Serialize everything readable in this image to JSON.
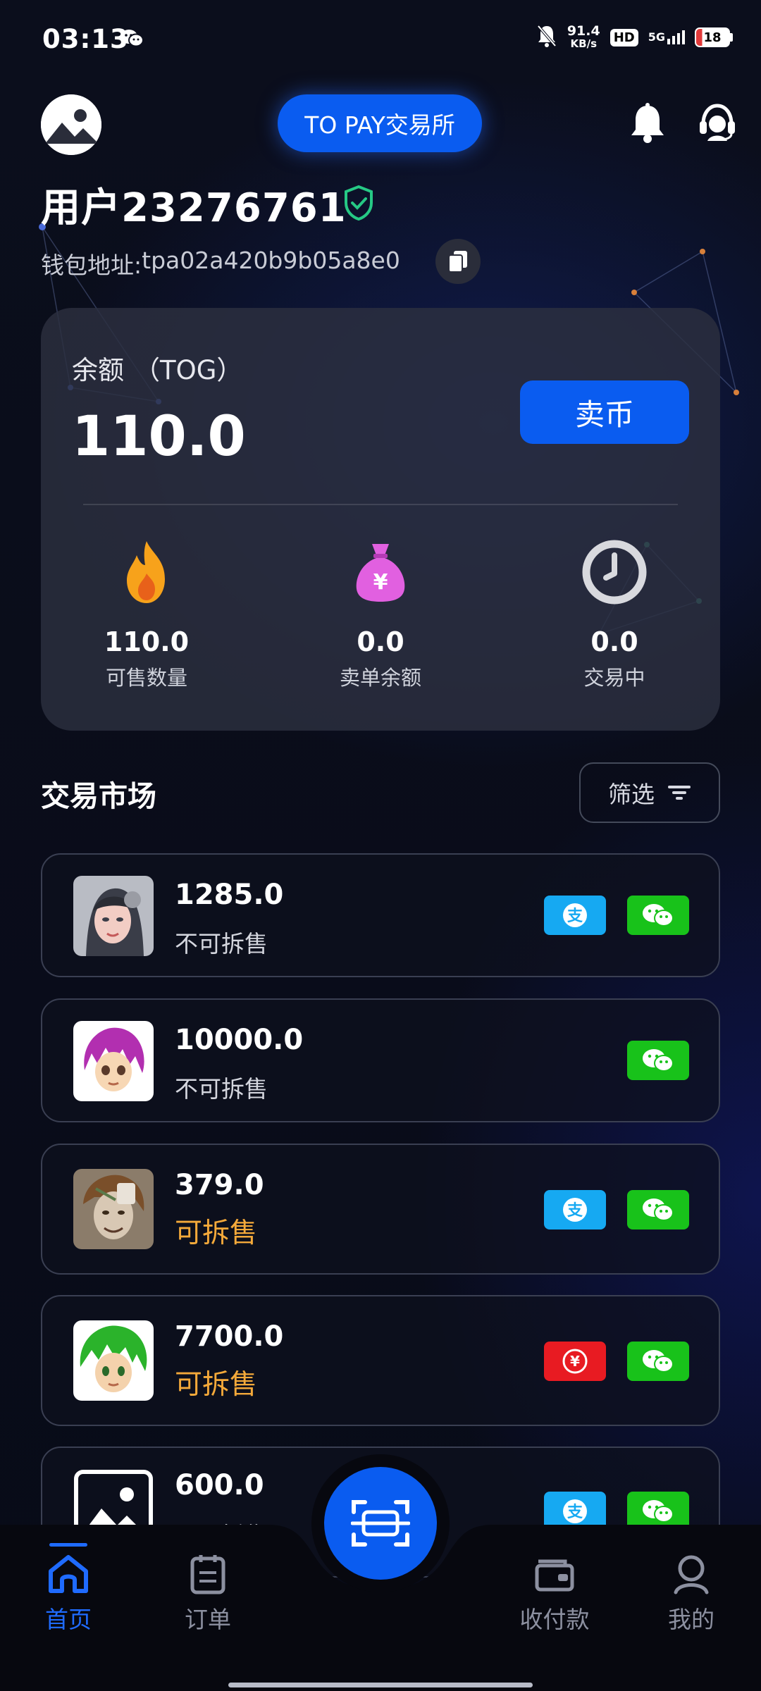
{
  "status_bar": {
    "time": "03:13",
    "net_speed_value": "91.4",
    "net_speed_unit": "KB/s",
    "hd": "HD",
    "network": "5G",
    "battery": "18"
  },
  "header": {
    "brand": "TO PAY交易所",
    "user_name": "用户23276761",
    "wallet_label": "钱包地址: ",
    "wallet_address": "tpa02a420b9b05a8e0"
  },
  "balance_card": {
    "label": "余额",
    "unit": "（TOG）",
    "value": "110.0",
    "sell_button": "卖币",
    "stats": [
      {
        "value": "110.0",
        "label": "可售数量",
        "icon": "fire-icon"
      },
      {
        "value": "0.0",
        "label": "卖单余额",
        "icon": "money-bag-icon"
      },
      {
        "value": "0.0",
        "label": "交易中",
        "icon": "clock-icon"
      }
    ]
  },
  "market": {
    "title": "交易市场",
    "filter_label": "筛选",
    "items": [
      {
        "amount": "1285.0",
        "status": "不可拆售",
        "splittable": false,
        "payments": [
          "alipay",
          "wechat"
        ]
      },
      {
        "amount": "10000.0",
        "status": "不可拆售",
        "splittable": false,
        "payments": [
          "wechat"
        ]
      },
      {
        "amount": "379.0",
        "status": "可拆售",
        "splittable": true,
        "payments": [
          "alipay",
          "wechat"
        ]
      },
      {
        "amount": "7700.0",
        "status": "可拆售",
        "splittable": true,
        "payments": [
          "unionpay",
          "wechat"
        ]
      },
      {
        "amount": "600.0",
        "status": "不可拆售",
        "splittable": false,
        "payments": [
          "alipay",
          "wechat"
        ]
      }
    ]
  },
  "bottom_nav": {
    "items": [
      {
        "label": "首页",
        "icon": "home-icon",
        "active": true
      },
      {
        "label": "订单",
        "icon": "orders-icon",
        "active": false
      },
      {
        "label": "收付款",
        "icon": "wallet-icon",
        "active": false
      },
      {
        "label": "我的",
        "icon": "profile-icon",
        "active": false
      }
    ],
    "center_action_icon": "scan-icon"
  },
  "colors": {
    "accent": "#0a5cf0",
    "splittable": "#f4a93a",
    "alipay": "#16a9f2",
    "wechat": "#18c21a",
    "unionpay": "#e81b22"
  }
}
